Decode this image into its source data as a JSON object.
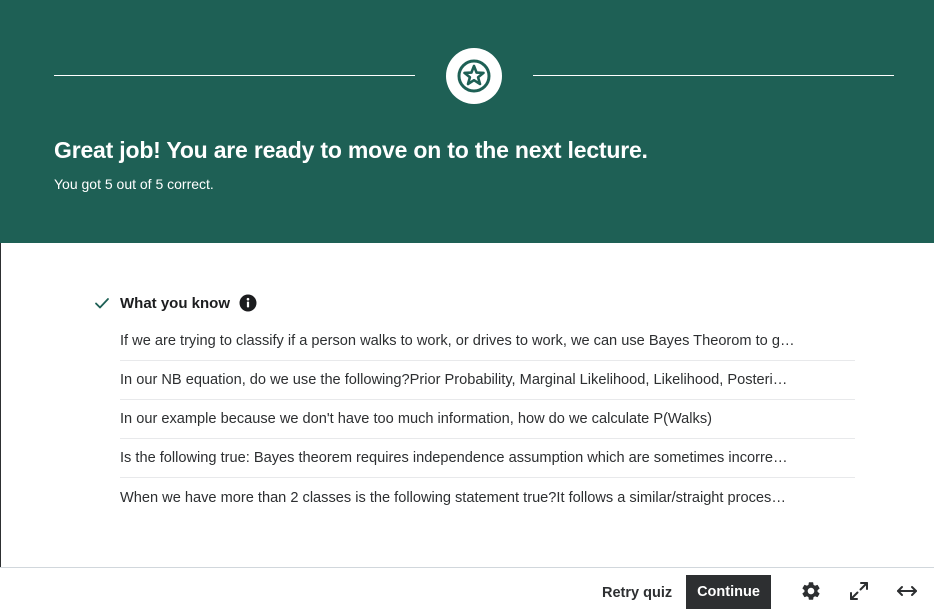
{
  "banner": {
    "headline": "Great job! You are ready to move on to the next lecture.",
    "score_text": "You got 5 out of 5 correct.",
    "background_color": "#1e6055",
    "badge_icon": "star-icon"
  },
  "knowledge": {
    "title": "What you know",
    "status_icon": "check-icon",
    "info_icon": "info-icon",
    "questions": [
      "If we are trying to classify if a person walks to work, or drives to work, we can use Bayes Theorom to g…",
      "In our NB equation, do we use the following?Prior Probability, Marginal Likelihood, Likelihood, Posteri…",
      "In our example because we don't have too much information, how do we calculate P(Walks)",
      "Is the following true: Bayes theorem requires independence assumption which are sometimes incorre…",
      "When we have more than 2 classes is the following statement true?It follows a similar/straight proces…"
    ]
  },
  "footer": {
    "retry_label": "Retry quiz",
    "continue_label": "Continue",
    "icons": [
      "gear-icon",
      "expand-icon",
      "widescreen-icon"
    ]
  }
}
